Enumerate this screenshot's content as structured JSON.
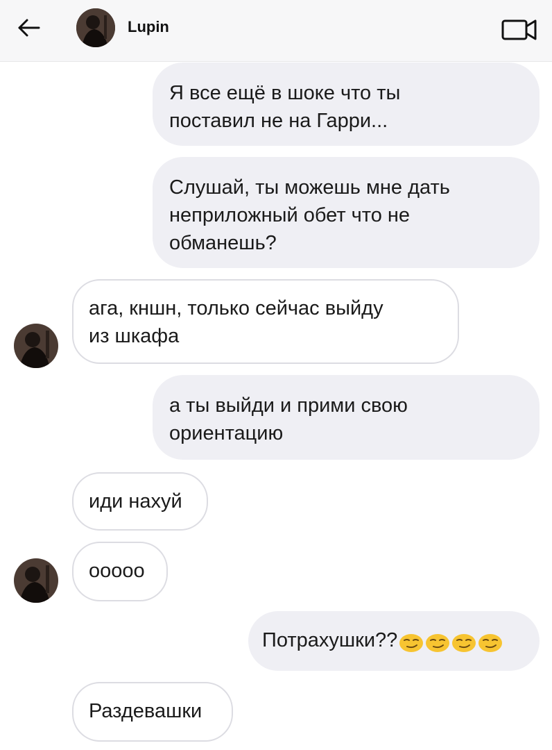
{
  "header": {
    "contact_name": "Lupin",
    "back_icon": "arrow-left-icon",
    "video_icon": "video-camera-icon",
    "avatar_icon": "contact-avatar"
  },
  "messages": [
    {
      "direction": "outgoing",
      "text_lines": [
        "Я все ещё в шоке что ты",
        "поставил не на Гарри..."
      ]
    },
    {
      "direction": "outgoing",
      "text_lines": [
        "Слушай, ты можешь мне дать",
        "неприложный обет что не",
        "обманешь?"
      ]
    },
    {
      "direction": "incoming",
      "text_lines": [
        "ага, кншн, только сейчас выйду",
        "из шкафа"
      ]
    },
    {
      "direction": "outgoing",
      "text_lines": [
        "а ты выйди и прими свою",
        "ориентацию"
      ]
    },
    {
      "direction": "incoming",
      "text_lines": [
        "иди нахуй"
      ]
    },
    {
      "direction": "incoming",
      "text_lines": [
        "ооооо"
      ]
    },
    {
      "direction": "outgoing",
      "text_lines": [
        "Потрахушки??"
      ],
      "emoji": [
        "smirk-emoji",
        "smirk-emoji",
        "smirk-emoji",
        "smirk-emoji"
      ]
    },
    {
      "direction": "incoming",
      "text_lines": [
        "Раздевашки"
      ]
    }
  ],
  "colors": {
    "outgoing_bubble": "#efeff4",
    "incoming_border": "#dcdce2",
    "header_bg": "#f7f7f8"
  }
}
